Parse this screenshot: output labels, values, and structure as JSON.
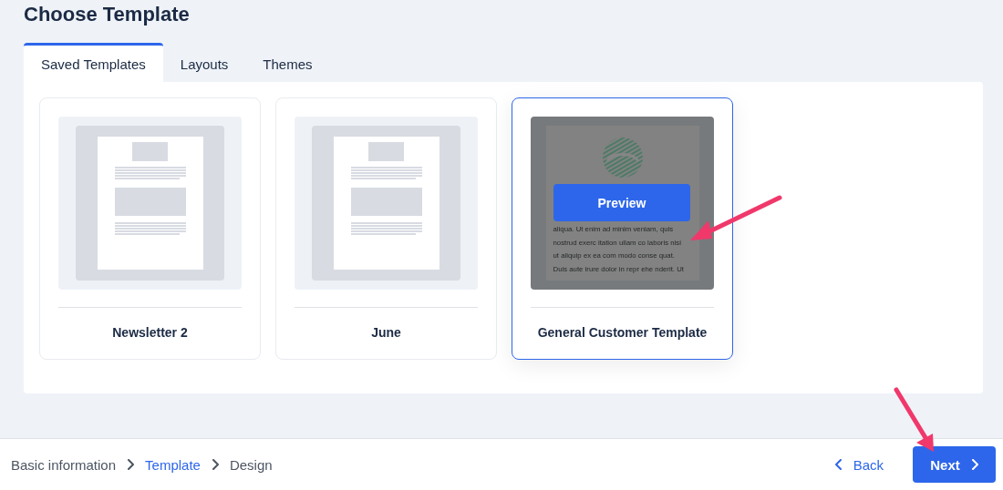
{
  "title": "Choose Template",
  "tabs": [
    {
      "label": "Saved Templates",
      "selected": true
    },
    {
      "label": "Layouts",
      "selected": false
    },
    {
      "label": "Themes",
      "selected": false
    }
  ],
  "templates": [
    {
      "name": "Newsletter 2",
      "selected": false,
      "thumbnail": {
        "kind": "placeholder"
      }
    },
    {
      "name": "June",
      "selected": false,
      "thumbnail": {
        "kind": "placeholder"
      }
    },
    {
      "name": "General Customer Template",
      "selected": true,
      "preview_button": "Preview",
      "thumbnail": {
        "kind": "document",
        "lines": [
          "aliqua. Ut enim ad minim veniam, quis",
          "nostrud exerc itation ullam co laboris nisi",
          "ut aliquip ex ea com modo conse quat.",
          "Duis aute irure dolor in repr ehe nderit. Ut"
        ]
      }
    }
  ],
  "breadcrumb": [
    {
      "label": "Basic information",
      "selected": false
    },
    {
      "label": "Template",
      "selected": true
    },
    {
      "label": "Design",
      "selected": false
    }
  ],
  "back_button": "Back",
  "next_button": "Next"
}
